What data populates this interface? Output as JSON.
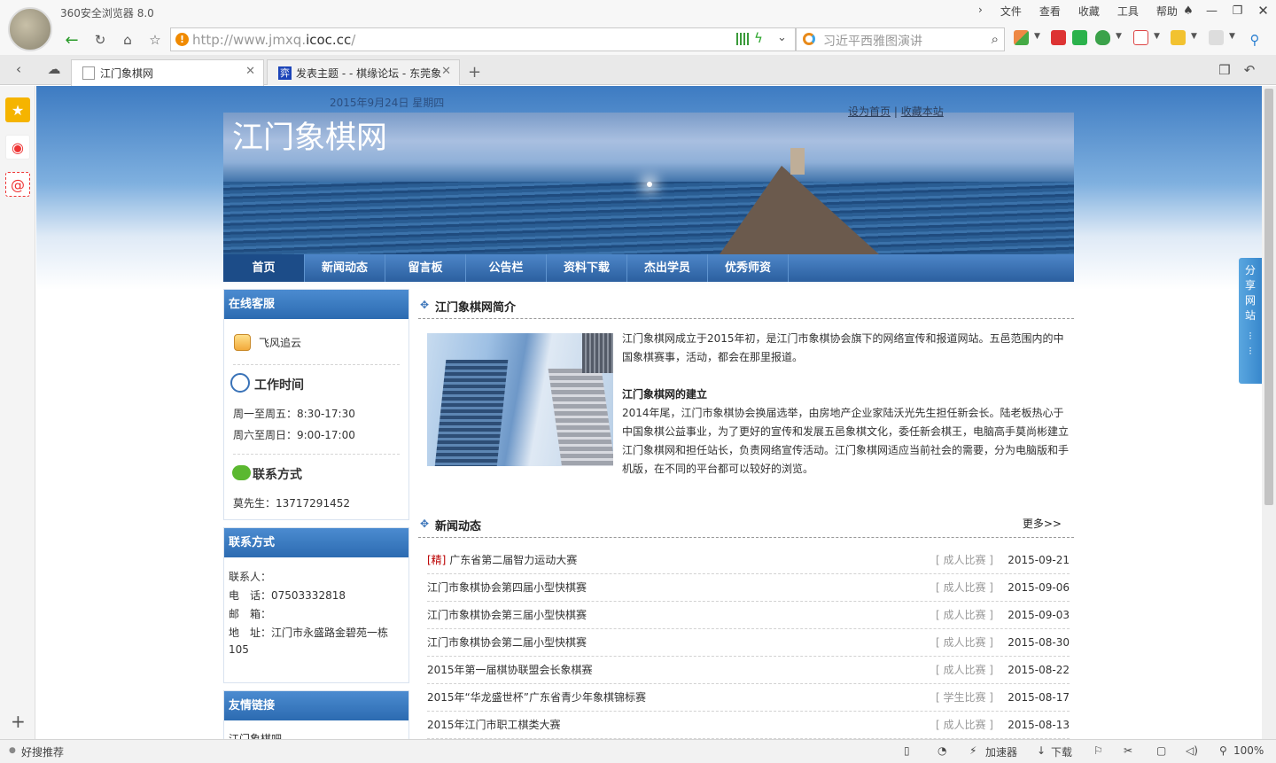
{
  "browser": {
    "app_title": "360安全浏览器 8.0",
    "menu": [
      "文件",
      "查看",
      "收藏",
      "工具",
      "帮助"
    ],
    "url_prefix": "http://www.jmxq.",
    "url_domain": "icoc.cc",
    "url_suffix": "/",
    "search_text": "习近平西雅图演讲",
    "tabs": [
      {
        "label": "江门象棋网",
        "active": true
      },
      {
        "label": "发表主题 - - 棋缘论坛 - 东莞象",
        "active": false
      }
    ],
    "status_left": "好搜推荐",
    "status_items": [
      "加速器",
      "下载"
    ],
    "zoom": "100%"
  },
  "site": {
    "date": "2015年9月24日 星期四",
    "name": "江门象棋网",
    "top_links": [
      "设为首页",
      "收藏本站"
    ],
    "top_sep": "|",
    "nav": [
      "首页",
      "新闻动态",
      "留言板",
      "公告栏",
      "资料下载",
      "杰出学员",
      "优秀师资"
    ],
    "service": {
      "title": "在线客服",
      "qq_name": "飞风追云",
      "hours_title": "工作时间",
      "hours": [
        "周一至周五：8:30-17:30",
        "周六至周日：9:00-17:00"
      ],
      "contact_title": "联系方式",
      "contact_line": "莫先生：13717291452"
    },
    "contact": {
      "title": "联系方式",
      "lines": [
        "联系人：",
        "电　话：07503332818",
        "邮　箱：",
        "地　址：江门市永盛路金碧苑一栋",
        "105"
      ]
    },
    "links": {
      "title": "友情链接",
      "first": "江门象棋吧"
    },
    "intro": {
      "title": "江门象棋网简介",
      "p1": "江门象棋网成立于2015年初，是江门市象棋协会旗下的网络宣传和报道网站。五邑范围内的中国象棋赛事，活动，都会在那里报道。",
      "h2": "江门象棋网的建立",
      "p2": "2014年尾，江门市象棋协会换届选举，由房地产企业家陆沃光先生担任新会长。陆老板热心于中国象棋公益事业，为了更好的宣传和发展五邑象棋文化，委任新会棋王，电脑高手莫尚彬建立江门象棋网和担任站长，负责网络宣传活动。江门象棋网适应当前社会的需要，分为电脑版和手机版，在不同的平台都可以较好的浏览。"
    },
    "news": {
      "title": "新闻动态",
      "more": "更多>>",
      "items": [
        {
          "tag": "[精]",
          "title": "广东省第二届智力运动大赛",
          "cat": "[ 成人比赛 ]",
          "date": "2015-09-21"
        },
        {
          "tag": "",
          "title": "江门市象棋协会第四届小型快棋赛",
          "cat": "[ 成人比赛 ]",
          "date": "2015-09-06"
        },
        {
          "tag": "",
          "title": "江门市象棋协会第三届小型快棋赛",
          "cat": "[ 成人比赛 ]",
          "date": "2015-09-03"
        },
        {
          "tag": "",
          "title": "江门市象棋协会第二届小型快棋赛",
          "cat": "[ 成人比赛 ]",
          "date": "2015-08-30"
        },
        {
          "tag": "",
          "title": "2015年第一届棋协联盟会长象棋赛",
          "cat": "[ 成人比赛 ]",
          "date": "2015-08-22"
        },
        {
          "tag": "",
          "title": "2015年“华龙盛世杯”广东省青少年象棋锦标赛",
          "cat": "[ 学生比赛 ]",
          "date": "2015-08-17"
        },
        {
          "tag": "",
          "title": "2015年江门市职工棋类大赛",
          "cat": "[ 成人比赛 ]",
          "date": "2015-08-13"
        }
      ]
    },
    "share_tab": [
      "分",
      "享",
      "网",
      "站"
    ]
  }
}
